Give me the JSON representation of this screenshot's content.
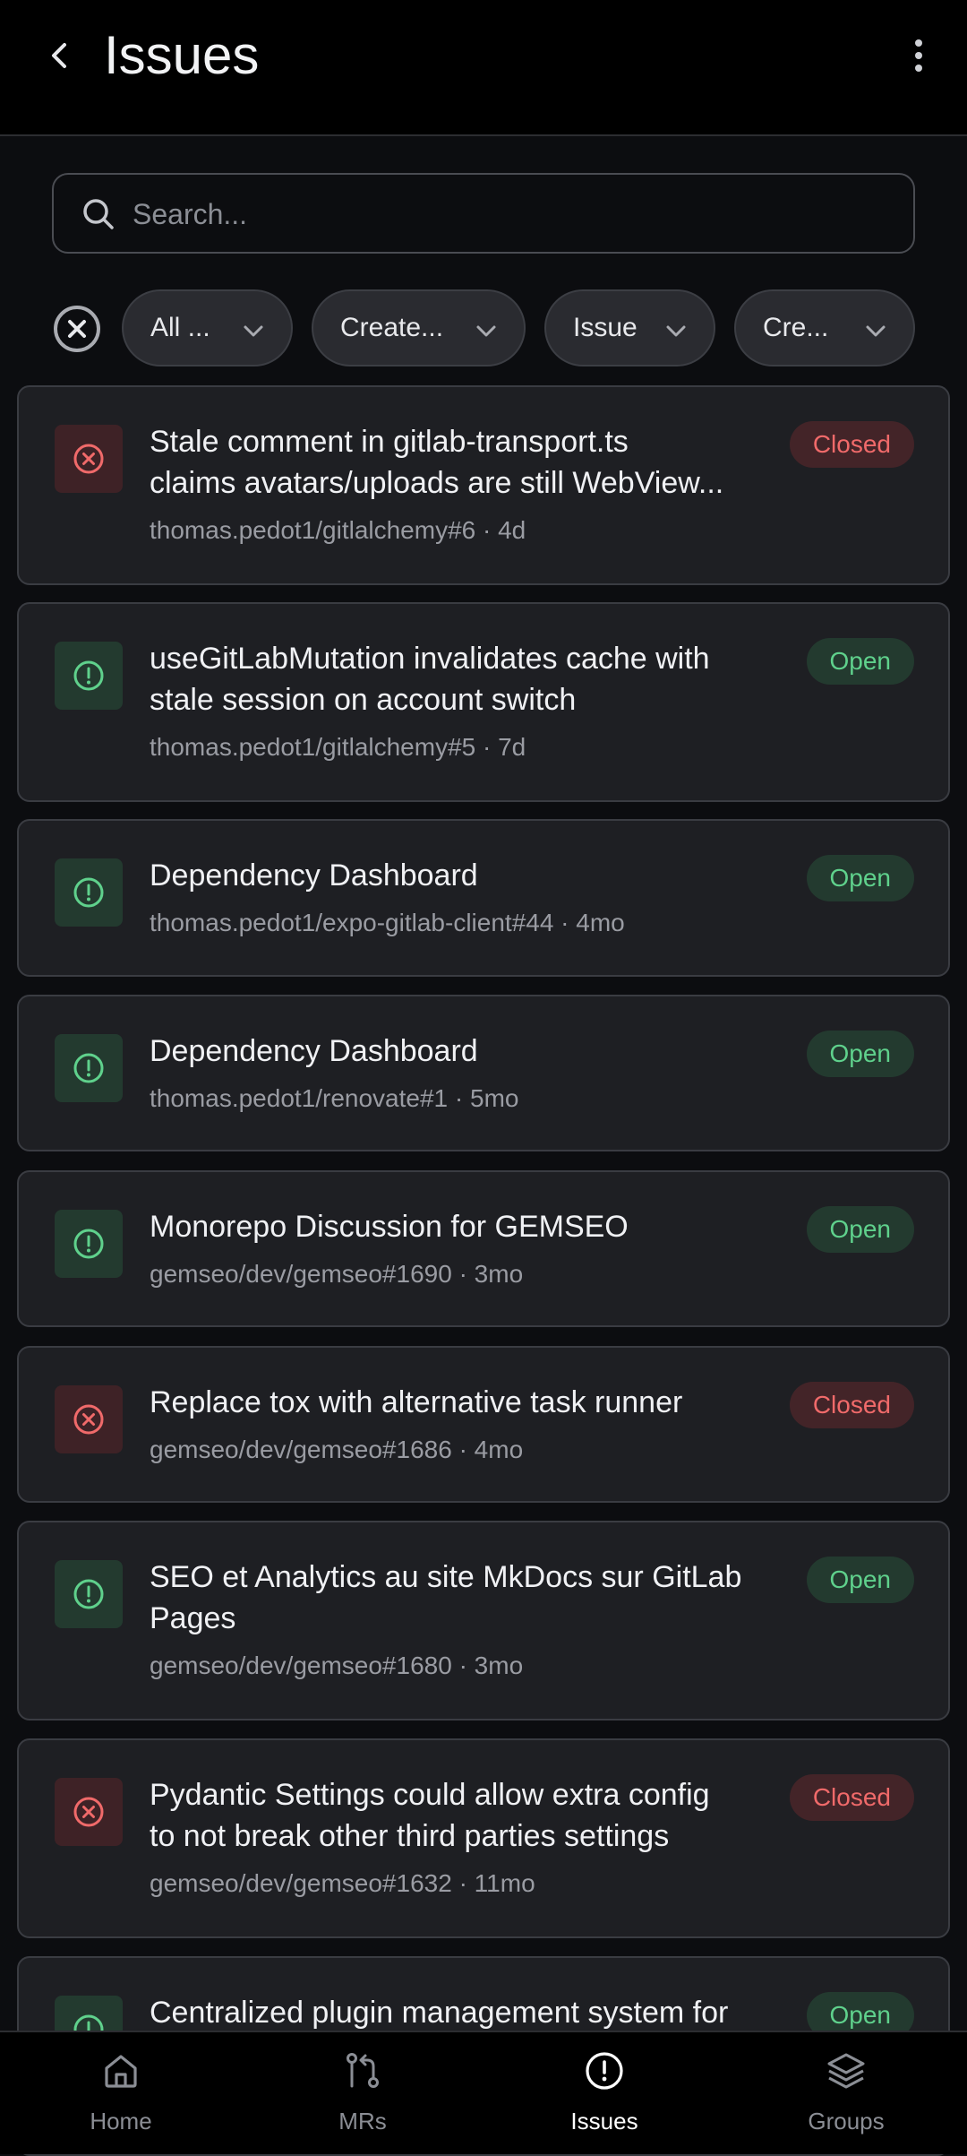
{
  "header": {
    "title": "Issues",
    "back_icon": "chevron-left-icon",
    "menu_icon": "more-vertical-icon"
  },
  "search": {
    "placeholder": "Search...",
    "value": ""
  },
  "filters": {
    "clear_icon": "x-circle-icon",
    "chips": [
      {
        "label": "All ..."
      },
      {
        "label": "Create..."
      },
      {
        "label": "Issue"
      },
      {
        "label": "Cre..."
      }
    ]
  },
  "colors": {
    "open": "#5fd18c",
    "closed": "#f06a6a",
    "card_bg": "#1e1f23",
    "app_bg": "#0c0d10"
  },
  "issues": [
    {
      "title_line1": "Stale comment in gitlab-transport.ts",
      "title_line2": "claims avatars/uploads are still WebView...",
      "meta": "thomas.pedot1/gitlalchemy#6 · 4d",
      "state": "Closed",
      "icon": "x-circle-icon"
    },
    {
      "title_line1": "useGitLabMutation invalidates cache with",
      "title_line2": "stale session on account switch",
      "meta": "thomas.pedot1/gitlalchemy#5 · 7d",
      "state": "Open",
      "icon": "alert-circle-icon"
    },
    {
      "title_line1": "Dependency Dashboard",
      "meta": "thomas.pedot1/expo-gitlab-client#44 · 4mo",
      "state": "Open",
      "icon": "alert-circle-icon"
    },
    {
      "title_line1": "Dependency Dashboard",
      "meta": "thomas.pedot1/renovate#1 · 5mo",
      "state": "Open",
      "icon": "alert-circle-icon"
    },
    {
      "title_line1": "Monorepo Discussion for GEMSEO",
      "meta": "gemseo/dev/gemseo#1690 · 3mo",
      "state": "Open",
      "icon": "alert-circle-icon"
    },
    {
      "title_line1": "Replace tox with alternative task runner",
      "meta": "gemseo/dev/gemseo#1686 · 4mo",
      "state": "Closed",
      "icon": "x-circle-icon"
    },
    {
      "title_line1": "SEO et Analytics au site MkDocs sur GitLab",
      "title_line2": "Pages",
      "meta": "gemseo/dev/gemseo#1680 · 3mo",
      "state": "Open",
      "icon": "alert-circle-icon"
    },
    {
      "title_line1": "Pydantic Settings could allow extra config",
      "title_line2": "to not break other third parties settings",
      "meta": "gemseo/dev/gemseo#1632 · 11mo",
      "state": "Closed",
      "icon": "x-circle-icon"
    },
    {
      "title_line1": "Centralized plugin management system for",
      "state": "Open",
      "icon": "alert-circle-icon"
    }
  ],
  "tabbar": {
    "active": "Issues",
    "tabs": [
      {
        "label": "Home",
        "icon": "home-icon"
      },
      {
        "label": "MRs",
        "icon": "merge-request-icon"
      },
      {
        "label": "Issues",
        "icon": "alert-circle-icon"
      },
      {
        "label": "Groups",
        "icon": "layers-icon"
      }
    ]
  }
}
